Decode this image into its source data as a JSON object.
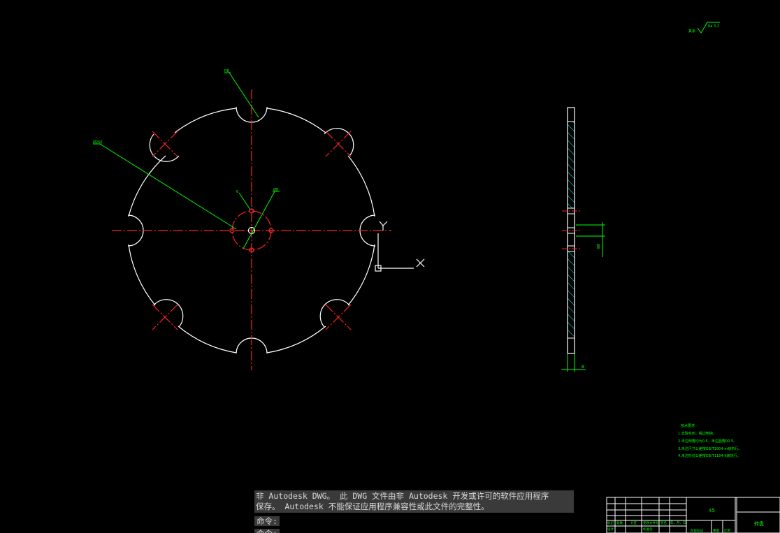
{
  "drawing": {
    "main_view_labels": {
      "leader_top": "R8",
      "leader_left": "Ø250",
      "leader_small_left": "6",
      "leader_small_right": "Ø8"
    },
    "surface_finish": "Ra 3.2",
    "surface_finish_prefix": "其余",
    "ucs": {
      "x_label": "X",
      "y_label": "Y"
    },
    "side_view_labels": {
      "thickness": "8",
      "hole_dim": "Ø8"
    },
    "tech_requirements": {
      "title": "技术要求",
      "items": [
        "1.去除毛刺，锐边倒钝。",
        "2.未注倒角均为0.5，未注圆角R0.5。",
        "3.未注尺寸公差按GB/T1804-m级执行。",
        "4.未注形位公差按GB/T1184-K级执行。"
      ]
    },
    "title_block": {
      "material": "45",
      "part_name": "转盘",
      "row_labels": [
        "标记",
        "处数",
        "分区",
        "更改文件号",
        "签名",
        "年、月、日"
      ],
      "row2_labels": [
        "设计",
        "标准化",
        "阶段标记",
        "重量",
        "比例"
      ]
    },
    "colors": {
      "outline": "#ffffff",
      "center": "#ff2020",
      "dimension": "#00ff00",
      "hatch": "#00ffff"
    }
  },
  "command": {
    "message_line1": "非 Autodesk DWG。  此 DWG 文件由非 Autodesk 开发或许可的软件应用程序",
    "message_line2": "保存。  Autodesk 不能保证应用程序兼容性或此文件的完整性。",
    "prompt1": "命令:",
    "prompt2": "命令:"
  }
}
